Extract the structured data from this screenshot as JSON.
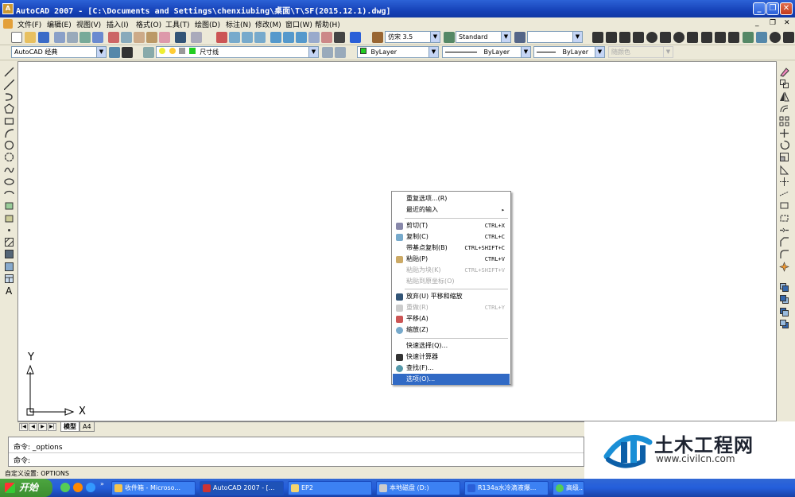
{
  "window": {
    "title": "AutoCAD 2007 - [C:\\Documents and Settings\\chenxiubing\\桌面\\T\\SF(2015.12.1).dwg]",
    "app_icon_text": "A"
  },
  "menu": [
    "文件(F)",
    "编辑(E)",
    "视图(V)",
    "插入(I)",
    "格式(O)",
    "工具(T)",
    "绘图(D)",
    "标注(N)",
    "修改(M)",
    "窗口(W)",
    "帮助(H)"
  ],
  "toolbar": {
    "text_style": "仿宋 3.5",
    "dim_style": "Standard",
    "table_style": "",
    "workspace": "AutoCAD 经典",
    "layer": "尺寸线",
    "color": "ByLayer",
    "linetype": "ByLayer",
    "lineweight": "ByLayer",
    "plotstyle": "随颜色"
  },
  "ucs": {
    "y_label": "Y",
    "x_label": "X"
  },
  "tabs": [
    "模型",
    "A4"
  ],
  "command": {
    "line1": "命令: _options",
    "line2": "命令:"
  },
  "status": "自定义设置: OPTIONS",
  "context_menu": [
    {
      "label": "重复选项...(R)",
      "shortcut": "",
      "disabled": false
    },
    {
      "label": "最近的输入",
      "shortcut": "",
      "disabled": false,
      "submenu": "▸"
    },
    {
      "label": "剪切(T)",
      "shortcut": "CTRL+X",
      "disabled": false
    },
    {
      "label": "复制(C)",
      "shortcut": "CTRL+C",
      "disabled": false
    },
    {
      "label": "带基点复制(B)",
      "shortcut": "CTRL+SHIFT+C",
      "disabled": false
    },
    {
      "label": "粘贴(P)",
      "shortcut": "CTRL+V",
      "disabled": false
    },
    {
      "label": "粘贴为块(K)",
      "shortcut": "CTRL+SHIFT+V",
      "disabled": true
    },
    {
      "label": "粘贴到原坐标(O)",
      "shortcut": "",
      "disabled": true
    },
    {
      "label": "放弃(U) 平移和缩放",
      "shortcut": "",
      "disabled": false
    },
    {
      "label": "重做(R)",
      "shortcut": "CTRL+Y",
      "disabled": true
    },
    {
      "label": "平移(A)",
      "shortcut": "",
      "disabled": false
    },
    {
      "label": "缩放(Z)",
      "shortcut": "",
      "disabled": false
    },
    {
      "label": "快速选择(Q)...",
      "shortcut": "",
      "disabled": false
    },
    {
      "label": "快速计算器",
      "shortcut": "",
      "disabled": false
    },
    {
      "label": "查找(F)...",
      "shortcut": "",
      "disabled": false
    },
    {
      "label": "选项(O)...",
      "shortcut": "",
      "disabled": false,
      "selected": true
    }
  ],
  "taskbar": {
    "start": "开始",
    "tasks": [
      "收件箱 - Microso...",
      "AutoCAD 2007 - [...",
      "EP2",
      "本地磁盘 (D:)",
      "R134a水冷滴液爆...",
      "高级..."
    ]
  },
  "watermark": {
    "name": "土木工程网",
    "url": "www.civilcn.com"
  }
}
